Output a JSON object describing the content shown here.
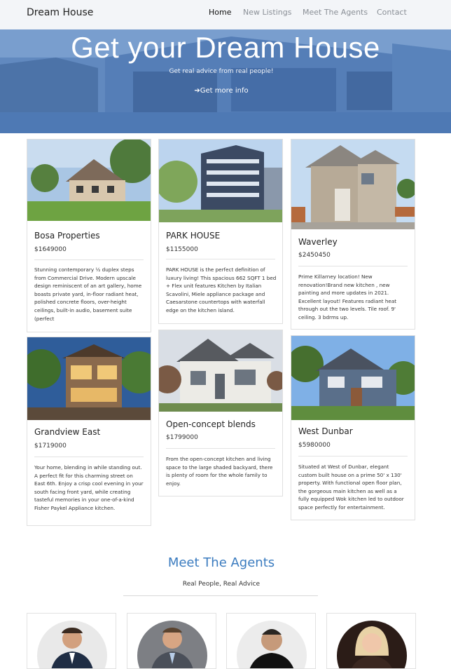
{
  "nav": {
    "brand": "Dream House",
    "links": [
      {
        "label": "Home",
        "active": true
      },
      {
        "label": "New Listings",
        "active": false
      },
      {
        "label": "Meet The Agents",
        "active": false
      },
      {
        "label": "Contact",
        "active": false
      }
    ]
  },
  "hero": {
    "title": "Get your Dream House",
    "subtitle": "Get real advice from real people!",
    "button_label": "Get more info",
    "button_icon": "arrow-right-circle-icon"
  },
  "listings": [
    {
      "title": "Bosa Properties",
      "price": "$1649000",
      "description": "Stunning contemporary ½ duplex steps from Commercial Drive. Modern upscale design reminiscent of an art gallery, home boasts private yard, in-floor radiant heat, polished concrete floors, over-height ceilings, built-in audio, basement suite (perfect"
    },
    {
      "title": "PARK HOUSE",
      "price": "$1155000",
      "description": "PARK HOUSE is the perfect definition of luxury living! This spacious 662 SQFT 1 bed + Flex unit features Kitchen by Italian Scavolini, Miele appliance package and Caesarstone countertops with waterfall edge on the kitchen island."
    },
    {
      "title": "Waverley",
      "price": "$2450450",
      "description": "Prime Killarney location! New renovation!Brand new kitchen , new painting and more updates in 2021. Excellent layout! Features radiant heat through out the two levels. Tile roof. 9' ceiling. 3 bdrms up."
    },
    {
      "title": "Grandview East",
      "price": "$1719000",
      "description": "Your home, blending in while standing out. A perfect fit for this charming street on East 6th. Enjoy a crisp cool evening in your south facing front yard, while creating tasteful memories in your one-of-a-kind Fisher Paykel Appliance kitchen."
    },
    {
      "title": "Open-concept blends",
      "price": "$1799000",
      "description": "From the open-concept kitchen and living space to the large shaded backyard, there is plenty of room for the whole family to enjoy."
    },
    {
      "title": "West Dunbar",
      "price": "$5980000",
      "description": "Situated at West of Dunbar, elegant custom built house on a prime 50' x 130' property. With functional open floor plan, the gorgeous main kitchen as well as a fully equipped Wok kitchen led to outdoor space perfectly for entertainment."
    }
  ],
  "agents": {
    "title": "Meet The Agents",
    "subtitle": "Real People, Real Advice"
  },
  "colors": {
    "accent": "#3a7bbf",
    "hero_overlay": "#4f7fc0",
    "navbar_bg": "#f3f5f8"
  }
}
